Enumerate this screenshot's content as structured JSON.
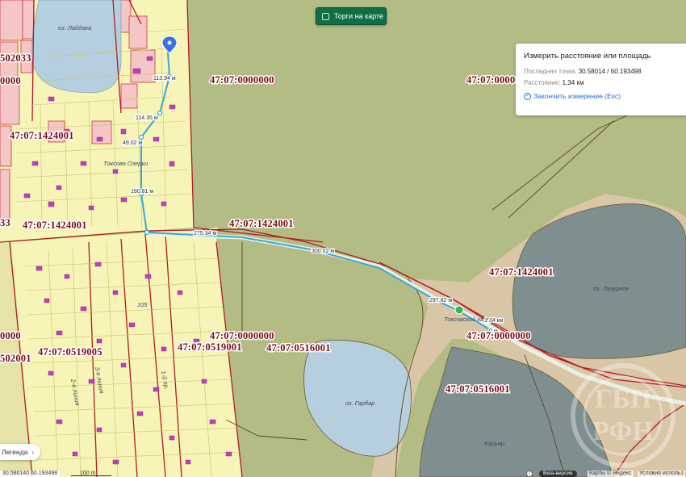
{
  "toolbar": {
    "torgi_label": "Торги на карте"
  },
  "measure_panel": {
    "title": "Измерить расстояние или площадь",
    "last_point_label": "Последняя точка:",
    "last_point_value": "30.58014 / 60.193498",
    "distance_label": "Расстояние:",
    "distance_value": "1,34 км",
    "finish_label": "Закончить измерение (Esc)"
  },
  "legend": {
    "label": "Легенда",
    "chevron": "›"
  },
  "bottom_bar": {
    "coords": "30.580140 60.193498",
    "scale": "100 m",
    "info_icon": "i",
    "beta_label": "Beta-версия",
    "copyright": "Карты © Яндекс",
    "terms": "Условия использ"
  },
  "parcels": {
    "p1": "47:07:0000000",
    "p2": "47:07:0000000",
    "p3": "502033",
    "p4": "0000",
    "p5": "47:07:1424001",
    "p6": "47:07:1424001",
    "p7": "33",
    "p8": "47:07:1424001",
    "p9": "47:07:1424001",
    "p10": "47:07:0000000",
    "p11": "47:07:0519001",
    "p12": "47:07:0516001",
    "p13": "47:07:0519005",
    "p14": "0000",
    "p15": "502001",
    "p16": "47:07:0000000",
    "p17": "47:07:0516001"
  },
  "places": {
    "laidaka": "оз. Лайдака",
    "toksovo_ozerki": "Токсово Озерки",
    "lazurnoe": "оз. Лазурное",
    "garbar": "оз. Гарбар",
    "toksovo_quarry": "Токсовский карьер",
    "quarry": "Карьер",
    "street_a": "2-я линия",
    "street_b": "3-я линия",
    "street_c": "1-й пр.",
    "house_105": "105"
  },
  "measure_segments": {
    "s1": "113.94 м",
    "s2": "114.35 м",
    "s3": "49.02 м",
    "s4": "190.81 м",
    "s5": "275.34 м",
    "s6": "300.02 м",
    "s7": "297.82 м",
    "s8": "1.34 км",
    "s9": "0 м"
  },
  "colors": {
    "background_forest": "#b3bc84",
    "lake": "#b5cfde",
    "lake_dark": "#7f8f8f",
    "quarry_sand": "#d9c6a6",
    "residential": "#f7f4b8",
    "parcel_border": "#b01b24",
    "measure_line": "#37a8d6",
    "buildings": "#c43dc0",
    "torgi_button": "#0f6e45",
    "link_blue": "#1d6fd1"
  },
  "icons": [
    "location-pin-icon",
    "checkbox-icon",
    "check-circle-icon",
    "chevron-right-icon",
    "info-icon",
    "quarry-marker-icon",
    "watermark-logo-icon"
  ]
}
